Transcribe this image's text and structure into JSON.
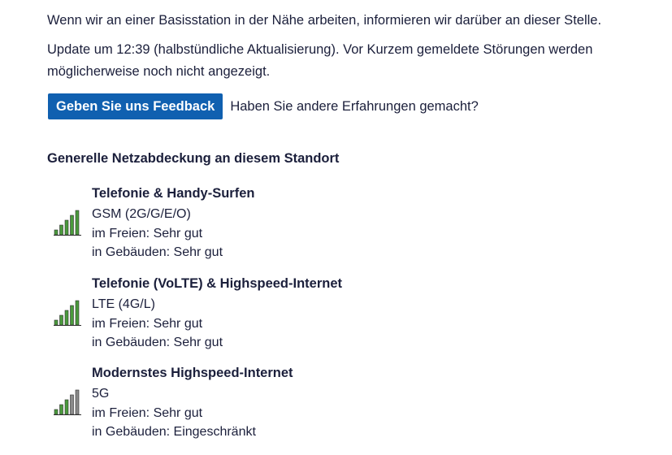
{
  "intro": {
    "maintenance_text": "Wenn wir an einer Basisstation in der Nähe arbeiten, informieren wir darüber an dieser Stelle.",
    "update_text_line1": "Update um 12:39 (halbstündliche Aktualisierung). Vor Kurzem gemeldete Störungen werden",
    "update_text_line2": "möglicherweise noch nicht angezeigt."
  },
  "feedback": {
    "button_label": "Geben Sie uns Feedback",
    "prompt": "Haben Sie andere Erfahrungen gemacht?"
  },
  "coverage": {
    "title": "Generelle Netzabdeckung an diesem Standort",
    "colors": {
      "bar_on": "#4a9a3c",
      "bar_off": "#8a8a8a"
    },
    "items": [
      {
        "title": "Telefonie & Handy-Surfen",
        "technology": "GSM (2G/G/E/O)",
        "outdoor": "im Freien: Sehr gut",
        "indoor": "in Gebäuden: Sehr gut",
        "icon": "signal-bars-icon",
        "signal_bars": 5,
        "signal_max": 5
      },
      {
        "title": "Telefonie (VoLTE) & Highspeed-Internet",
        "technology": "LTE (4G/L)",
        "outdoor": "im Freien: Sehr gut",
        "indoor": "in Gebäuden: Sehr gut",
        "icon": "signal-bars-icon",
        "signal_bars": 5,
        "signal_max": 5
      },
      {
        "title": "Modernstes Highspeed-Internet",
        "technology": "5G",
        "outdoor": "im Freien: Sehr gut",
        "indoor": "in Gebäuden: Eingeschränkt",
        "icon": "signal-bars-icon",
        "signal_bars": 3,
        "signal_max": 5
      }
    ]
  }
}
